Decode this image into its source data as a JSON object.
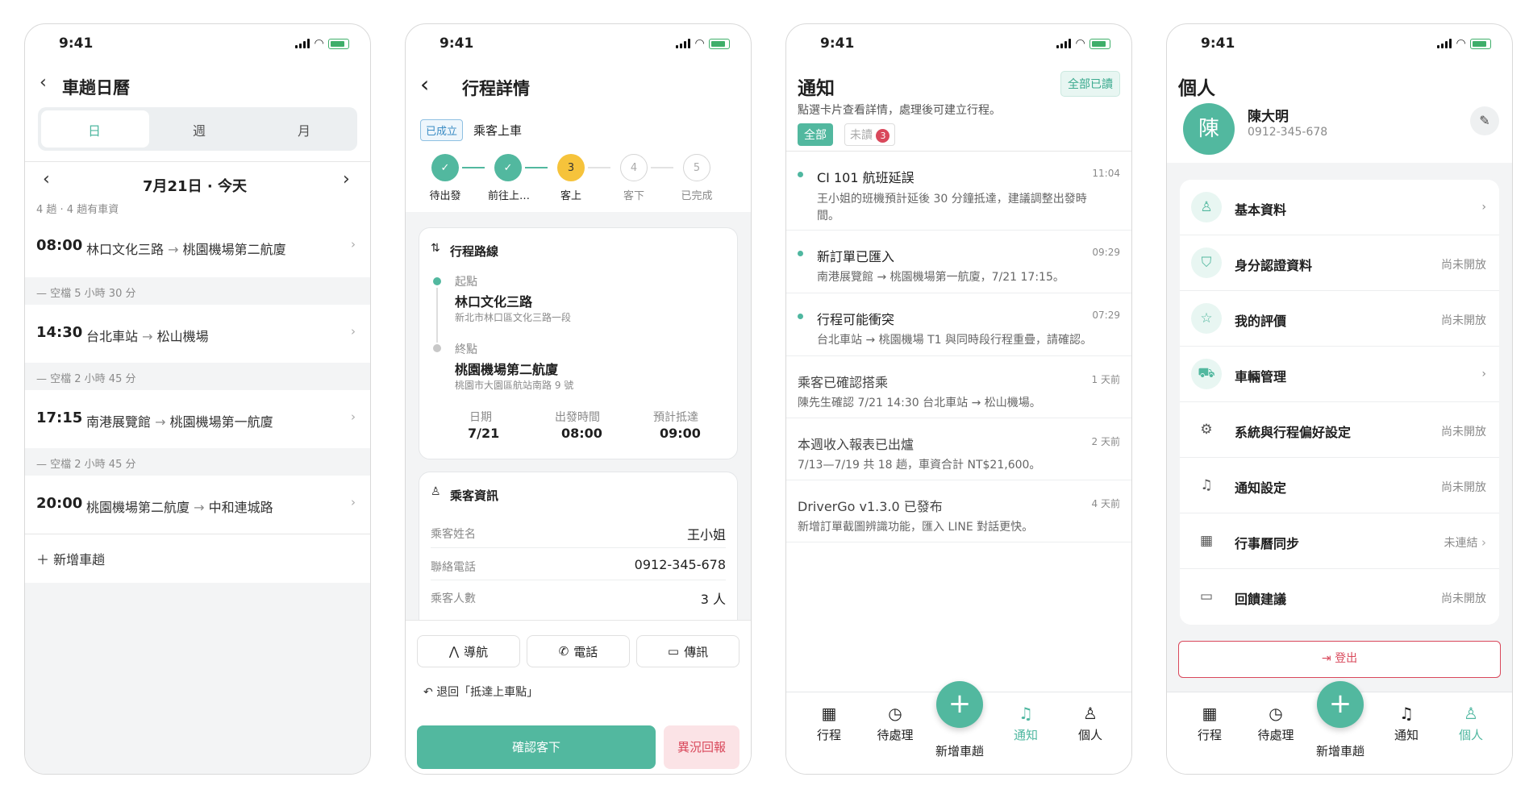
{
  "status_time": "9:41",
  "colors": {
    "accent": "#52b89f",
    "accent_light": "#e8f6f2",
    "danger": "#d9485b",
    "danger_light": "#fbe3e6"
  },
  "calendar": {
    "title": "車趟日曆",
    "tabs": [
      "日",
      "週",
      "月"
    ],
    "date": "7月21日 · 今天",
    "summary": "4 趟 · 4 趟有車資",
    "trips": [
      {
        "time": "08:00",
        "from": "林口文化三路",
        "to": "桃園機場第二航廈",
        "gap": "空檔 5 小時 30 分"
      },
      {
        "time": "14:30",
        "from": "台北車站",
        "to": "松山機場",
        "gap": "空檔 2 小時 45 分"
      },
      {
        "time": "17:15",
        "from": "南港展覽館",
        "to": "桃園機場第一航廈",
        "gap": "空檔 2 小時 45 分"
      },
      {
        "time": "20:00",
        "from": "桃園機場第二航廈",
        "to": "中和連城路",
        "gap": ""
      }
    ],
    "arrow": "→",
    "add_label": "新增車趟"
  },
  "detail": {
    "title": "行程詳情",
    "badge": "已成立",
    "status": "乘客上車",
    "steps": [
      {
        "label": "待出發",
        "mark": "✓",
        "state": "done"
      },
      {
        "label": "前往上…",
        "mark": "✓",
        "state": "done"
      },
      {
        "label": "客上",
        "mark": "3",
        "state": "current"
      },
      {
        "label": "客下",
        "mark": "4",
        "state": "todo"
      },
      {
        "label": "已完成",
        "mark": "5",
        "state": "todo"
      }
    ],
    "route_title": "行程路線",
    "origin_label": "起點",
    "origin_name": "林口文化三路",
    "origin_addr": "新北市林口區文化三路一段",
    "dest_label": "終點",
    "dest_name": "桃園機場第二航廈",
    "dest_addr": "桃園市大園區航站南路 9 號",
    "date_label": "日期",
    "date_value": "7/21",
    "depart_label": "出發時間",
    "depart_value": "08:00",
    "eta_label": "預計抵達",
    "eta_value": "09:00",
    "pax_title": "乘客資訊",
    "pax_rows": [
      {
        "label": "乘客姓名",
        "value": "王小姐"
      },
      {
        "label": "聯絡電話",
        "value": "0912-345-678"
      },
      {
        "label": "乘客人數",
        "value": "3 人"
      }
    ],
    "nav_btn": "導航",
    "call_btn": "電話",
    "msg_btn": "傳訊",
    "revert": "退回「抵達上車點」",
    "confirm_btn": "確認客下",
    "report_btn": "異況回報"
  },
  "notify": {
    "title": "通知",
    "read_all": "全部已讀",
    "subtitle": "點選卡片查看詳情，處理後可建立行程。",
    "filter_all": "全部",
    "filter_unread": "未讀",
    "unread_count": "3",
    "items": [
      {
        "title": "CI 101 航班延誤",
        "time": "11:04",
        "body": "王小姐的班機預計延後 30 分鐘抵達，建議調整出發時",
        "body2": "間。",
        "unread": true
      },
      {
        "title": "新訂單已匯入",
        "time": "09:29",
        "body": "南港展覽館 → 桃園機場第一航廈，7/21 17:15。",
        "body2": "",
        "unread": true
      },
      {
        "title": "行程可能衝突",
        "time": "07:29",
        "body": "台北車站 → 桃園機場 T1 與同時段行程重疊，請確認。",
        "body2": "",
        "unread": true
      },
      {
        "title": "乘客已確認搭乘",
        "time": "1 天前",
        "body": "陳先生確認 7/21 14:30 台北車站 → 松山機場。",
        "body2": "",
        "unread": false
      },
      {
        "title": "本週收入報表已出爐",
        "time": "2 天前",
        "body": "7/13—7/19 共 18 趟，車資合計 NT$21,600。",
        "body2": "",
        "unread": false
      },
      {
        "title": "DriverGo v1.3.0 已發布",
        "time": "4 天前",
        "body": "新增訂單截圖辨識功能，匯入 LINE 對話更快。",
        "body2": "",
        "unread": false
      }
    ]
  },
  "profile": {
    "title": "個人",
    "avatar": "陳",
    "name": "陳大明",
    "phone": "0912-345-678",
    "items": [
      {
        "label": "基本資料",
        "right": "",
        "icon": "user-icon"
      },
      {
        "label": "身分認證資料",
        "right": "尚未開放",
        "icon": "shield-icon"
      },
      {
        "label": "我的評價",
        "right": "尚未開放",
        "icon": "star-icon"
      },
      {
        "label": "車輛管理",
        "right": "",
        "icon": "car-icon"
      },
      {
        "label": "系統與行程偏好設定",
        "right": "尚未開放",
        "icon": "gear-icon"
      },
      {
        "label": "通知設定",
        "right": "尚未開放",
        "icon": "bell-icon"
      },
      {
        "label": "行事曆同步",
        "right": "未連結",
        "icon": "calendar-icon"
      },
      {
        "label": "回饋建議",
        "right": "尚未開放",
        "icon": "chat-icon"
      }
    ],
    "logout": "登出"
  },
  "tabbar": {
    "trips": "行程",
    "pending": "待處理",
    "add": "新增車趟",
    "notify": "通知",
    "me": "個人"
  }
}
